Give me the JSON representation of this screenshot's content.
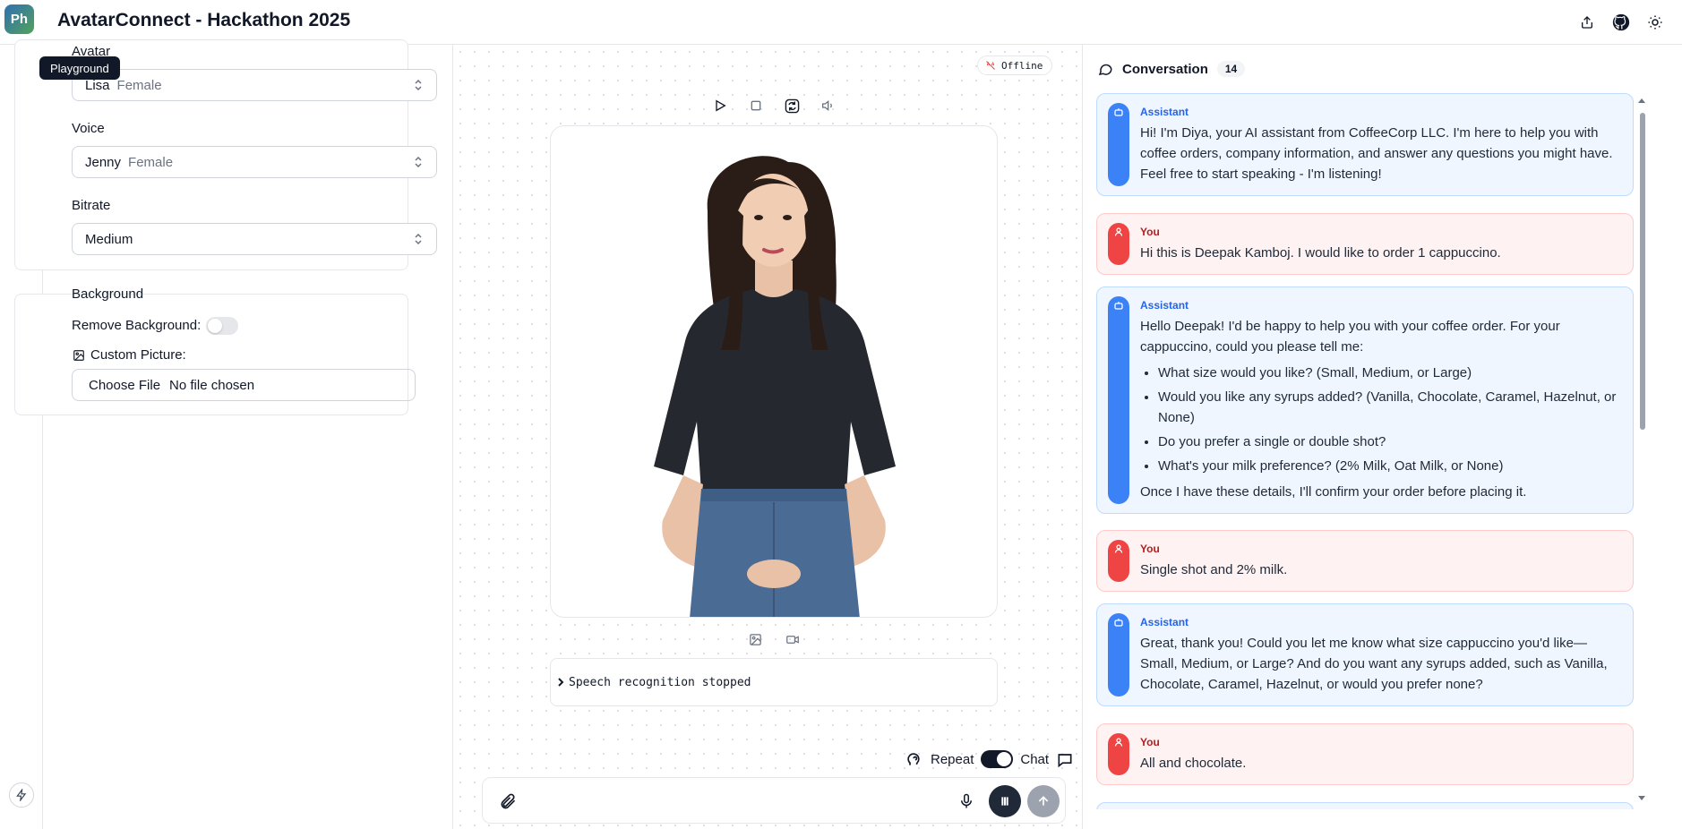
{
  "app": {
    "title": "AvatarConnect - Hackathon 2025",
    "logo_text": "Ph"
  },
  "nav": {
    "tooltip": "Playground",
    "items": [
      {
        "name": "playground-icon"
      },
      {
        "name": "bot-icon"
      },
      {
        "name": "code-icon"
      },
      {
        "name": "settings-icon"
      },
      {
        "name": "layout-icon"
      },
      {
        "name": "cart-icon"
      }
    ]
  },
  "settings": {
    "avatar": {
      "label": "Avatar",
      "value": "Lisa",
      "detail": "Female"
    },
    "voice": {
      "label": "Voice",
      "value": "Jenny",
      "detail": "Female"
    },
    "bitrate": {
      "label": "Bitrate",
      "value": "Medium"
    },
    "background": {
      "title": "Background",
      "remove_label": "Remove Background:",
      "remove_enabled": false,
      "custom_label": "Custom Picture:",
      "file_button": "Choose File",
      "file_status": "No file chosen"
    }
  },
  "stage": {
    "status": "Offline",
    "log_text": "Speech recognition stopped",
    "mode_left": "Repeat",
    "mode_right": "Chat",
    "chat_mode_enabled": true
  },
  "conversation": {
    "title": "Conversation",
    "count": "14",
    "messages": [
      {
        "role": "Assistant",
        "text": "Hi! I'm Diya, your AI assistant from CoffeeCorp LLC. I'm here to help you with coffee orders, company information, and answer any questions you might have. Feel free to start speaking - I'm listening!"
      },
      {
        "role": "You",
        "text": "Hi this is Deepak Kamboj. I would like to order 1 cappuccino."
      },
      {
        "role": "Assistant",
        "text": "Hello Deepak! I'd be happy to help you with your coffee order. For your cappuccino, could you please tell me:",
        "bullets": [
          "What size would you like? (Small, Medium, or Large)",
          "Would you like any syrups added? (Vanilla, Chocolate, Caramel, Hazelnut, or None)",
          "Do you prefer a single or double shot?",
          "What's your milk preference? (2% Milk, Oat Milk, or None)"
        ],
        "footer": "Once I have these details, I'll confirm your order before placing it."
      },
      {
        "role": "You",
        "text": "Single shot and 2% milk."
      },
      {
        "role": "Assistant",
        "text": "Great, thank you! Could you let me know what size cappuccino you'd like—Small, Medium, or Large? And do you want any syrups added, such as Vanilla, Chocolate, Caramel, Hazelnut, or would you prefer none?"
      },
      {
        "role": "You",
        "text": "All and chocolate."
      }
    ]
  },
  "colors": {
    "assistant": "#3b82f6",
    "user": "#ef4444",
    "accent_dark": "#111827"
  }
}
